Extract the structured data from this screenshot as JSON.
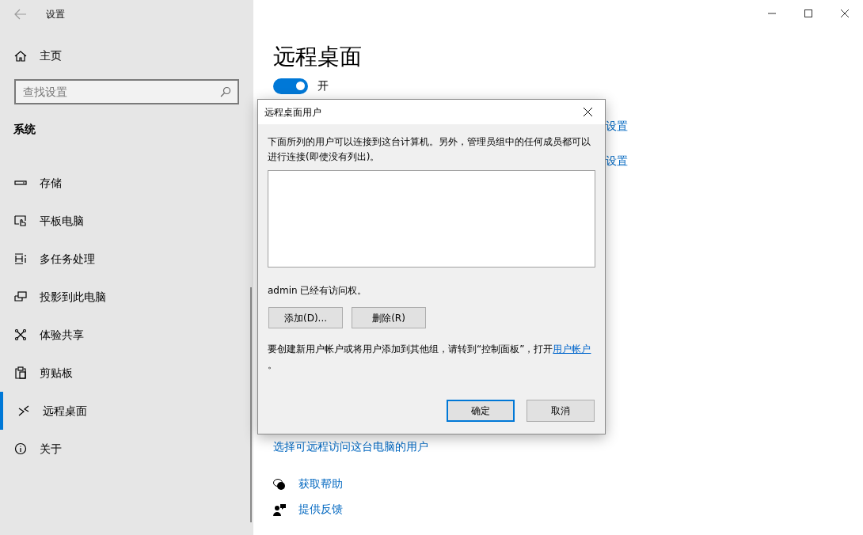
{
  "window": {
    "title": "设置"
  },
  "sidebar": {
    "home": "主页",
    "search": {
      "placeholder": "查找设置"
    },
    "section": "系统",
    "items": [
      {
        "label": "存储",
        "selected": false
      },
      {
        "label": "平板电脑",
        "selected": false
      },
      {
        "label": "多任务处理",
        "selected": false
      },
      {
        "label": "投影到此电脑",
        "selected": false
      },
      {
        "label": "体验共享",
        "selected": false
      },
      {
        "label": "剪贴板",
        "selected": false
      },
      {
        "label": "远程桌面",
        "selected": true
      },
      {
        "label": "关于",
        "selected": false
      }
    ]
  },
  "page": {
    "title": "远程桌面",
    "toggle": {
      "on": true,
      "label": "开"
    },
    "links": [
      "设置",
      "设置"
    ],
    "users_link": "选择可远程访问这台电脑的用户",
    "help": [
      {
        "label": "获取帮助"
      },
      {
        "label": "提供反馈"
      }
    ]
  },
  "dialog": {
    "title": "远程桌面用户",
    "description": "下面所列的用户可以连接到这台计算机。另外，管理员组中的任何成员都可以进行连接(即使没有列出)。",
    "access": "admin 已经有访问权。",
    "buttons": [
      {
        "label": "添加(D)...",
        "default": false
      },
      {
        "label": "删除(R)",
        "default": false
      }
    ],
    "info": {
      "text": "要创建新用户帐户或将用户添加到其他组，请转到“控制面板”，打开",
      "link": "用户帐户",
      "end": "。"
    },
    "footer_buttons": [
      {
        "label": "确定",
        "default": true
      },
      {
        "label": "取消",
        "default": false
      }
    ]
  }
}
